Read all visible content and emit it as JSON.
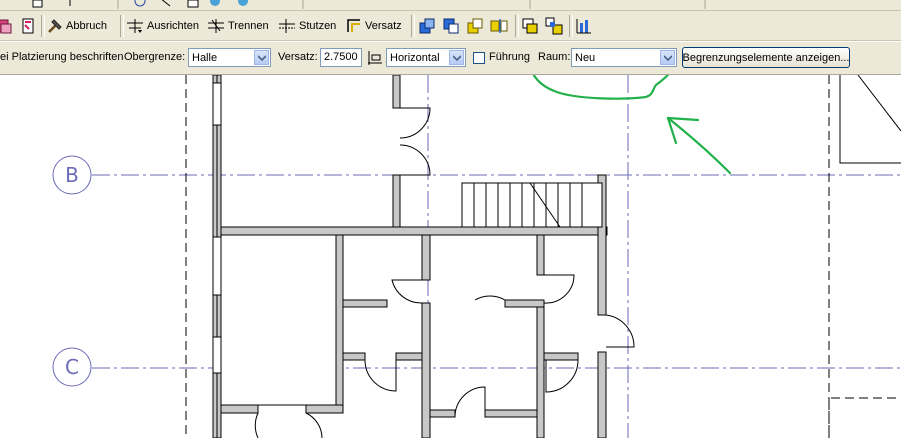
{
  "toolbar": {
    "abbruch": "Abbruch",
    "ausrichten": "Ausrichten",
    "trennen": "Trennen",
    "stutzen": "Stutzen",
    "versatz": "Versatz"
  },
  "options": {
    "platzierung_label": "ei Platzierung beschriften",
    "obergrenze_label": "Obergrenze:",
    "obergrenze_value": "Halle",
    "versatz_label": "Versatz:",
    "versatz_value": "2.7500",
    "orientation_value": "Horizontal",
    "fuehrung_label": "Führung",
    "raum_label": "Raum:",
    "raum_value": "Neu",
    "begrenzung_button": "Begrenzungselemente anzeigen..."
  },
  "grid": {
    "b_label": "B",
    "c_label": "C"
  },
  "colors": {
    "toolbar_bg": "#ece9d8",
    "grid_line": "#6b6bb8",
    "wall_fill": "#c8c8c8",
    "annotation_green": "#22b04a"
  }
}
